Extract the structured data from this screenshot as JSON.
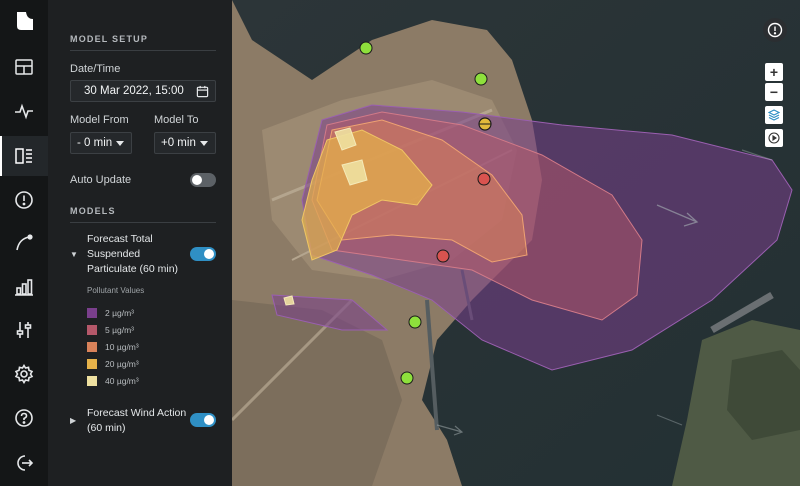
{
  "rail": {
    "icons": [
      "logo-icon",
      "dashboard-icon",
      "activity-icon",
      "models-icon",
      "alert-icon",
      "route-icon",
      "chart-icon",
      "sliders-icon",
      "settings-icon",
      "help-icon",
      "logout-icon"
    ],
    "active": "models-icon"
  },
  "panel": {
    "model_setup_title": "MODEL SETUP",
    "datetime_label": "Date/Time",
    "datetime_value": "30 Mar 2022, 15:00",
    "model_from_label": "Model From",
    "model_from_value": "- 0 min",
    "model_to_label": "Model To",
    "model_to_value": "+0 min",
    "auto_update_label": "Auto Update",
    "auto_update_on": false,
    "models_title": "MODELS",
    "models": [
      {
        "name": "Forecast Total Suspended Particulate (60 min)",
        "enabled": true,
        "expanded": true
      },
      {
        "name": "Forecast Wind Action (60 min)",
        "enabled": true,
        "expanded": false
      }
    ],
    "legend": {
      "title": "Pollutant Values",
      "items": [
        {
          "label": "2 µg/m³",
          "color": "#7a3f8c"
        },
        {
          "label": "5 µg/m³",
          "color": "#b5586a"
        },
        {
          "label": "10 µg/m³",
          "color": "#d9825a"
        },
        {
          "label": "20 µg/m³",
          "color": "#e6b24a"
        },
        {
          "label": "40 µg/m³",
          "color": "#eee0a0"
        }
      ]
    }
  },
  "map": {
    "controls": [
      "zoom-in-icon",
      "zoom-out-icon",
      "layers-icon",
      "play-icon"
    ],
    "zoom_in": "+",
    "zoom_out": "−",
    "station_colors": {
      "good": "#8ee03c",
      "moderate": "#e2b93b",
      "poor": "#d9534f"
    }
  }
}
